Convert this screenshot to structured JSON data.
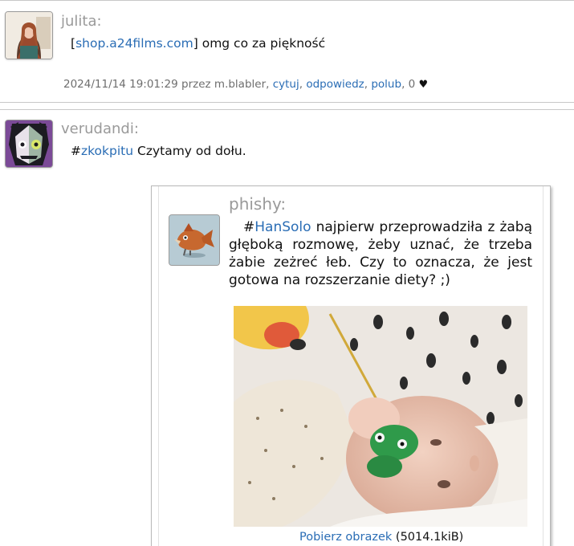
{
  "posts": [
    {
      "author": "julita:",
      "link_open": "[",
      "link_text": "shop.a24films.com",
      "link_close": "]",
      "text": " omg co za piękność",
      "meta": {
        "timestamp": "2024/11/14 19:01:29",
        "by": " przez m.blabler, ",
        "quote": "cytuj",
        "sep1": ", ",
        "reply": "odpowiedz",
        "sep2": ", ",
        "like": "polub",
        "count": ", 0 ",
        "heart": "♥"
      }
    },
    {
      "author": "verudandi:",
      "hash": "#",
      "tag": "zkokpitu",
      "text": " Czytamy od dołu.",
      "embed": {
        "author": "phishy:",
        "hash": "#",
        "tag": "HanSolo",
        "text": " najpierw przeprowadziła z żabą głęboką rozmowę, żeby uznać, że trzeba żabie zeżreć łeb. Czy to oznacza, że jest gotowa na rozszerzanie diety? ;)",
        "download_label": "Pobierz obrazek",
        "download_size": " (5014.1kiB)"
      }
    }
  ],
  "icons": {
    "heart": "heart-icon"
  },
  "colors": {
    "link": "#2a6db5",
    "author": "#9a9a9a",
    "meta": "#6e6e6e"
  }
}
